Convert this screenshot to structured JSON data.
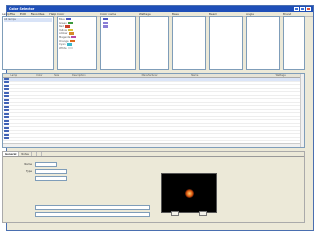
{
  "window": {
    "title": "Color Selector",
    "menu": [
      "File",
      "Edit",
      "Favorites",
      "Help"
    ]
  },
  "filters": {
    "headers": [
      "Lamp",
      "Color",
      "Color name",
      "Wattage",
      "Base",
      "Beam",
      "Angle",
      "Brand"
    ],
    "colors": {
      "accent": "#1f4fb8",
      "swatch_blue": "#4b57c4",
      "swatch_violet": "#8a7ed6",
      "swatch_red": "#c8402b",
      "swatch_green": "#3c9a3c"
    },
    "col0": [
      "All lamps",
      "",
      "",
      "",
      "",
      "",
      "",
      "",
      "",
      ""
    ],
    "col1": [
      "",
      "Blue",
      "Green",
      "Red",
      "Yellow",
      "Amber",
      "Magenta",
      "Orange",
      "Cyan",
      "White"
    ],
    "col2": [
      "",
      "",
      "",
      "",
      "",
      "",
      "",
      "",
      "",
      ""
    ],
    "col3": [
      "",
      "",
      "",
      "",
      "",
      "",
      "",
      "",
      "",
      ""
    ],
    "col4": [
      "",
      "",
      "",
      "",
      "",
      "",
      "",
      "",
      "",
      ""
    ],
    "col5": [
      "",
      "",
      "",
      "",
      "",
      "",
      "",
      "",
      "",
      ""
    ],
    "col6": [
      "",
      "",
      "",
      "",
      "",
      "",
      "",
      "",
      "",
      ""
    ],
    "col7": [
      "",
      "",
      "",
      "",
      "",
      "",
      "",
      "",
      "",
      ""
    ]
  },
  "results": {
    "columns": [
      "",
      "Lamp",
      "Color",
      "Size",
      "Description",
      "Manufacturer",
      "Name",
      "Wattage",
      ""
    ],
    "rows": [
      [
        "",
        "",
        "",
        "",
        "",
        "",
        "",
        "",
        ""
      ],
      [
        "",
        "",
        "",
        "",
        "",
        "",
        "",
        "",
        ""
      ],
      [
        "",
        "",
        "",
        "",
        "",
        "",
        "",
        "",
        ""
      ],
      [
        "",
        "",
        "",
        "",
        "",
        "",
        "",
        "",
        ""
      ],
      [
        "",
        "",
        "",
        "",
        "",
        "",
        "",
        "",
        ""
      ],
      [
        "",
        "",
        "",
        "",
        "",
        "",
        "",
        "",
        ""
      ],
      [
        "",
        "",
        "",
        "",
        "",
        "",
        "",
        "",
        ""
      ],
      [
        "",
        "",
        "",
        "",
        "",
        "",
        "",
        "",
        ""
      ],
      [
        "",
        "",
        "",
        "",
        "",
        "",
        "",
        "",
        ""
      ],
      [
        "",
        "",
        "",
        "",
        "",
        "",
        "",
        "",
        ""
      ],
      [
        "",
        "",
        "",
        "",
        "",
        "",
        "",
        "",
        ""
      ],
      [
        "",
        "",
        "",
        "",
        "",
        "",
        "",
        "",
        ""
      ],
      [
        "",
        "",
        "",
        "",
        "",
        "",
        "",
        "",
        ""
      ],
      [
        "",
        "",
        "",
        "",
        "",
        "",
        "",
        "",
        ""
      ],
      [
        "",
        "",
        "",
        "",
        "",
        "",
        "",
        "",
        ""
      ],
      [
        "",
        "",
        "",
        "",
        "",
        "",
        "",
        "",
        ""
      ],
      [
        "",
        "",
        "",
        "",
        "",
        "",
        "",
        "",
        ""
      ],
      [
        "",
        "",
        "",
        "",
        "",
        "",
        "",
        "",
        ""
      ]
    ]
  },
  "detail": {
    "tabs": [
      "General",
      "Notes",
      "",
      ""
    ],
    "fields": [
      {
        "label": "Name",
        "value": ""
      },
      {
        "label": "Type",
        "value": ""
      },
      {
        "label": "",
        "value": ""
      }
    ],
    "long_fields": [
      {
        "label": "",
        "value": ""
      },
      {
        "label": "",
        "value": ""
      }
    ],
    "buttons": [
      "",
      ""
    ]
  }
}
